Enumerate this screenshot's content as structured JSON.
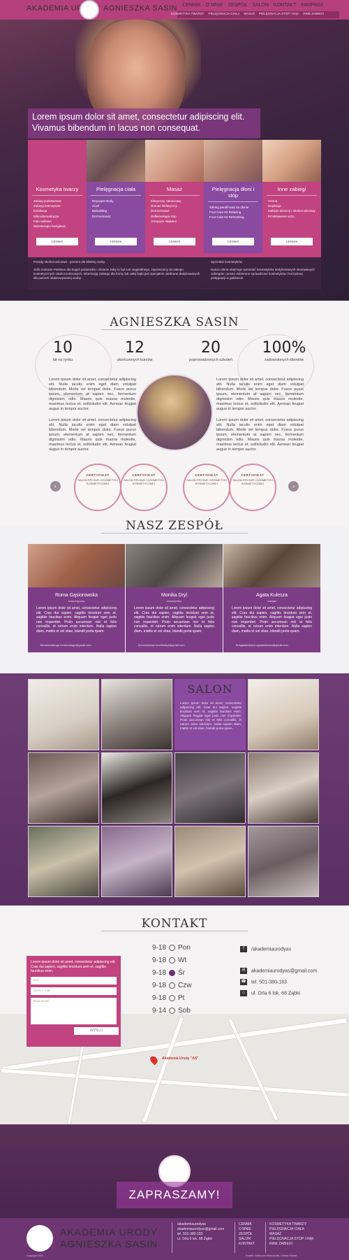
{
  "header": {
    "brand_left": "AKADEMIA URODY",
    "brand_right": "AGNIESZKA SASIN",
    "nav": [
      "CENNIK",
      "O MNIE",
      "ZESPÓŁ",
      "SALON",
      "KONTAKT",
      "FANPAGE"
    ],
    "subnav": [
      "KOSMETYKA TWARZY",
      "PIELĘGNACJA CIAŁA",
      "MASAŻ",
      "PIELĘGNACJA STÓP I RĄK",
      "INNE ZABIEGI"
    ]
  },
  "hero": {
    "tagline": "Lorem ipsum dolor sit amet, consectetur adipiscing elit. Vivamus bibendum in lacus non consequat.",
    "services": [
      {
        "title": "Kosmetyka twarzy",
        "items": [
          "Zabieg podstawowe",
          "Zabiegi intensywne",
          "Exfoliacja",
          "Mikrodermabrazja",
          "Fala radiowa",
          "Mezoterapia bezigłowa"
        ],
        "button": "CENNIK"
      },
      {
        "title": "Pielęgnacja ciała",
        "items": [
          "Rejuvgen Body",
          "xCell",
          "Bebuilding",
          "Dermomasaż"
        ],
        "button": "CENNIK"
      },
      {
        "title": "Masaż",
        "items": [
          "Klasyczny całościowy",
          "Drenaż limfatyczny",
          "Dermomasaż",
          "Refleksologia stóp",
          "Gorącymi olejkami"
        ],
        "button": "CENNIK"
      },
      {
        "title": "Pielęgnacja dłoni i stóp",
        "items": [
          "Zabieg parafinowy na dłonie",
          "Foot Care Kit Relaxing",
          "Foot Care Kit Refreshing"
        ],
        "button": "CENNIK"
      },
      {
        "title": "Inne zabiegi",
        "items": [
          "Henna",
          "Depilacja",
          "Makijaż dzienny i okolicznościowy",
          "Przekłuwanie uszu"
        ],
        "button": "CENNIK"
      }
    ],
    "note_left_title": "Porady okolicznościowe - prezent dla bliskiej osoby",
    "note_left_text": "Jeśli szukacie Państwo dla kogoś podarunku i chcecie żeby to był coś oryginalnego, zapraszamy do zakupu kosmetycznych okolicznościowych. Informację zabiegu dla formy lub całej bajki jest specjalnie odebrane dedykowanych dla potrzeb obdarowywanej osoby.",
    "note_right_title": "Sprzedaż kosmetyków",
    "note_right_text": "Nasza oferta obejmuje sprzedaż kosmetyków dedykowanych stosowanych zabiegów i prosto dobierane sprawdzone kosmetyków i korzystnej pielęgnacji w gabinecie."
  },
  "about": {
    "title": "AGNIESZKA SASIN",
    "stats": [
      {
        "number": "10",
        "label": "lat na rynku"
      },
      {
        "number": "12",
        "label": "ukończonych kursów"
      },
      {
        "number": "20",
        "label": "poprowadzonych szkoleń"
      },
      {
        "number": "100%",
        "label": "zadowolonych klientów"
      }
    ],
    "paragraph": "Lorem ipsum dolor sit amet, consectetur adipiscing elit. Nulla iaculis enim eget diam volutpat bibendum. Morbi vel tempus dolor. Fusce purus ipsum, elementum at sapien nec, fermentum dignissim odio. Mauris quis massa molestie, maximus lectus et, sollicitudin elit. Aenean feugiat augue in tempor auctor.",
    "cert_heading": "CERTYFIKAT",
    "cert_subtitle": "SALON FRYZUR I KOSMETYKI KOSMETYCZNEJ",
    "cert_prev": "‹",
    "cert_next": "›"
  },
  "team": {
    "title": "NASZ ZESPÓŁ",
    "members": [
      {
        "name": "Roma Gąsiorowska",
        "role": "kosmetyczka",
        "text": "Lorem ipsum dolor sit amet, consectetur adipiscing elit. Cras dui sapien, sagittis tincidunt sem et, sagittis faucibus enim. Aliquam feugiat eget justo non imperdiet. Proin accumsan nisi et felis convallis, et rutrum enim interdum. Nulla sapien diam, mattis et vel vitae, blandit porta quam.",
        "contact": "fb/romanadoga     romanadoga@gmail.com"
      },
      {
        "name": "Monika Dryl",
        "role": "masażystka",
        "text": "Lorem ipsum dolor sit amet, consectetur adipiscing elit. Cras dui sapien, sagittis tincidunt sem et, sagittis faucibus enim. Aliquam feugiat eget justo non imperdiet. Proin accumsan nisi et felis convallis, et rutrum enim interdum. Nulla sapien diam, mattis et vel vitae, blandit porta quam.",
        "contact": "fb/monikadryl     monikadryl@gmail.com"
      },
      {
        "name": "Agata Kulesza",
        "role": "makijaż",
        "text": "Lorem ipsum dolor sit amet, consectetur adipiscing elit. Cras dui sapien, sagittis tincidunt sem et, sagittis faucibus enim. Aliquam feugiat eget justo non imperdiet. Proin accumsan nisi et felis convallis, et rutrum enim interdum. Nulla sapien diam, mattis et vel vitae, blandit porta quam.",
        "contact": "fb/agatakulesza     agatakulesza@gmail.com"
      }
    ]
  },
  "salon": {
    "title": "SALON",
    "text": "Lorem ipsum dolor sit amet, consectetur adipiscing elit. Cras dui sapien, sagittis tincidunt sem et, sagittis faucibus enim. Aliquam feugiat eget justo non imperdiet. Proin accumsan nisi et felis convallis, et rutrum enim interdum. Nulla sapien diam, mattis et vel vitae, blandit porta quam."
  },
  "contact": {
    "title": "KONTAKT",
    "hours": [
      {
        "time": "9-18",
        "day": "Pon",
        "active": false
      },
      {
        "time": "9-18",
        "day": "Wt",
        "active": false
      },
      {
        "time": "9-18",
        "day": "Śr",
        "active": true
      },
      {
        "time": "9-18",
        "day": "Czw",
        "active": false
      },
      {
        "time": "9-18",
        "day": "Pt",
        "active": false
      },
      {
        "time": "9-14",
        "day": "Sob",
        "active": false
      }
    ],
    "facebook": "/akademiaurodyas",
    "email": "akademiaurodyas@gmail.com",
    "phone": "tel. 501-380-183",
    "address": "ul. Orla 6 lok. 68 Ząbki",
    "form_text": "Lorem ipsum dolor sit amet, consectetur adipiscing elit. Cras dui sapien, sagittis tincidunt sem et, sagittis faucibus enim.",
    "field_name": "Imię",
    "field_email": "Adres e-mail",
    "field_message": "Wiadomość",
    "send": "WYŚLIJ",
    "map_label": "Akademia Urody \"AS\""
  },
  "invite": {
    "text": "ZAPRASZAMY!"
  },
  "footer": {
    "name1": "AKADEMIA URODY",
    "name2": "AGNIESZKA SASIN",
    "contacts": [
      "/akademiaurodyas",
      "akademiaurodyas@gmail.com",
      "tel. 501-380-183",
      "ul. Orla 6 lok. 68 Ząbki"
    ],
    "links": [
      "CENNIK",
      "O MNIE",
      "ZESPÓŁ",
      "SALON",
      "KONTAKT"
    ],
    "services": [
      "KOSMETYKA TWARZY",
      "PIELĘGNACJA CIAŁA",
      "MASAŻ",
      "PIELĘGNACJA STÓP I RĄK",
      "INNE ZABIEGI"
    ],
    "copyright": "Copyright 2015",
    "credit": "Projekt: Katarzyna Wawrzyniak, Damian Rybak"
  }
}
